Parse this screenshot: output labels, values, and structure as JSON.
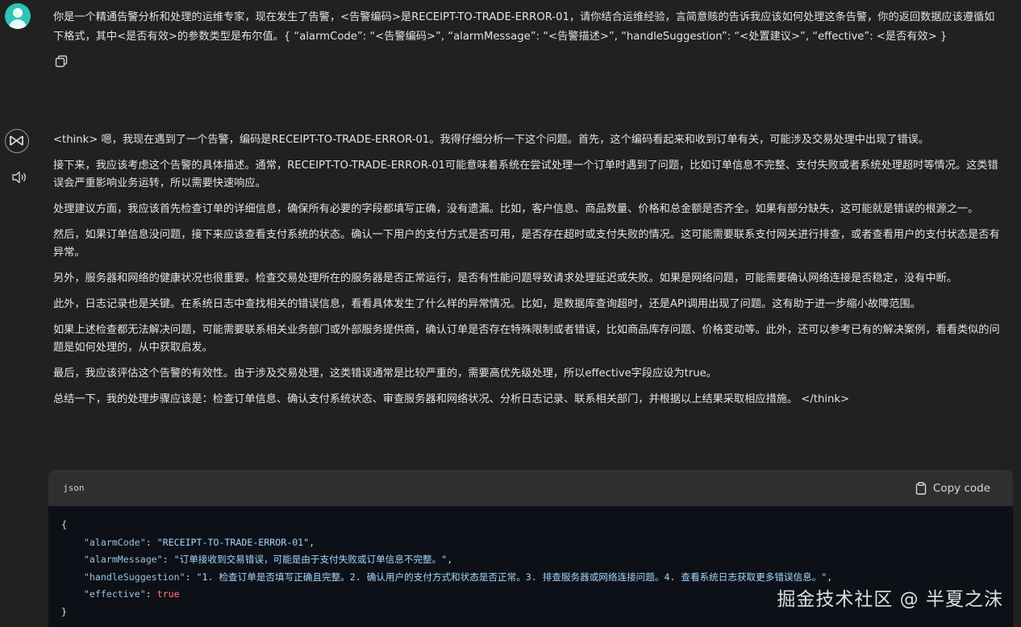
{
  "user_message": {
    "text": "你是一个精通告警分析和处理的运维专家，现在发生了告警，<告警编码>是RECEIPT-TO-TRADE-ERROR-01，请你结合运维经验，言简意赅的告诉我应该如何处理这条告警，你的返回数据应该遵循如下格式，其中<是否有效>的参数类型是布尔值。{ “alarmCode”: “<告警编码>”, “alarmMessage”: “<告警描述>”, “handleSuggestion”: “<处置建议>”, “effective”: <是否有效> }"
  },
  "assistant": {
    "paragraphs": [
      "<think> 嗯，我现在遇到了一个告警，编码是RECEIPT-TO-TRADE-ERROR-01。我得仔细分析一下这个问题。首先，这个编码看起来和收到订单有关，可能涉及交易处理中出现了错误。",
      "接下来，我应该考虑这个告警的具体描述。通常，RECEIPT-TO-TRADE-ERROR-01可能意味着系统在尝试处理一个订单时遇到了问题，比如订单信息不完整、支付失败或者系统处理超时等情况。这类错误会严重影响业务运转，所以需要快速响应。",
      "处理建议方面，我应该首先检查订单的详细信息，确保所有必要的字段都填写正确，没有遗漏。比如，客户信息、商品数量、价格和总金额是否齐全。如果有部分缺失，这可能就是错误的根源之一。",
      "然后，如果订单信息没问题，接下来应该查看支付系统的状态。确认一下用户的支付方式是否可用，是否存在超时或支付失败的情况。这可能需要联系支付网关进行排查，或者查看用户的支付状态是否有异常。",
      "另外，服务器和网络的健康状况也很重要。检查交易处理所在的服务器是否正常运行，是否有性能问题导致请求处理延迟或失败。如果是网络问题，可能需要确认网络连接是否稳定，没有中断。",
      "此外，日志记录也是关键。在系统日志中查找相关的错误信息，看看具体发生了什么样的异常情况。比如，是数据库查询超时，还是API调用出现了问题。这有助于进一步缩小故障范围。",
      "如果上述检查都无法解决问题，可能需要联系相关业务部门或外部服务提供商，确认订单是否存在特殊限制或者错误，比如商品库存问题、价格变动等。此外，还可以参考已有的解决案例，看看类似的问题是如何处理的，从中获取启发。",
      "最后，我应该评估这个告警的有效性。由于涉及交易处理，这类错误通常是比较严重的，需要高优先级处理，所以effective字段应设为true。",
      "总结一下，我的处理步骤应该是：检查订单信息、确认支付系统状态、审查服务器和网络状况、分析日志记录、联系相关部门，并根据以上结果采取相应措施。 </think>"
    ]
  },
  "code_block": {
    "language": "json",
    "copy_label": "Copy code",
    "open_brace": "{",
    "close_brace": "}",
    "lines": [
      {
        "key": "\"alarmCode\"",
        "value": "\"RECEIPT-TO-TRADE-ERROR-01\"",
        "trail": ","
      },
      {
        "key": "\"alarmMessage\"",
        "value": "\"订单接收到交易错误，可能是由于支付失败或订单信息不完整。\"",
        "trail": ","
      },
      {
        "key": "\"handleSuggestion\"",
        "value": "\"1. 检查订单是否填写正确且完整。2. 确认用户的支付方式和状态是否正常。3. 排查服务器或网络连接问题。4. 查看系统日志获取更多错误信息。\"",
        "trail": ","
      },
      {
        "key": "\"effective\"",
        "value": "true",
        "trail": ""
      }
    ]
  },
  "watermark": "掘金技术社区 @ 半夏之沫",
  "icons": {
    "user_avatar": "user-avatar",
    "copy_message": "copy-icon",
    "assistant_avatar": "deepseek-logo-icon",
    "read_aloud": "speaker-icon",
    "copy_code": "clipboard-icon"
  },
  "colors": {
    "background": "#212121",
    "code_header": "#2f2f2f",
    "code_body": "#0d1117",
    "avatar": "#2ec4b6",
    "string": "#a5d6ff",
    "boolean": "#ff7b72"
  }
}
